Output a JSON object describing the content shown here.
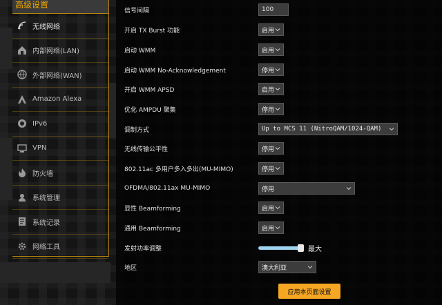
{
  "sidebar": {
    "title": "高级设置",
    "items": [
      {
        "label": "无线网络",
        "icon": "wifi-icon"
      },
      {
        "label": "内部网络(LAN)",
        "icon": "home-icon"
      },
      {
        "label": "外部网络(WAN)",
        "icon": "globe-icon"
      },
      {
        "label": "Amazon Alexa",
        "icon": "alexa-icon"
      },
      {
        "label": "IPv6",
        "icon": "ipv6-icon"
      },
      {
        "label": "VPN",
        "icon": "vpn-icon"
      },
      {
        "label": "防火墙",
        "icon": "firewall-icon"
      },
      {
        "label": "系统管理",
        "icon": "admin-icon"
      },
      {
        "label": "系统记录",
        "icon": "log-icon"
      },
      {
        "label": "网络工具",
        "icon": "tools-icon"
      }
    ]
  },
  "settings": {
    "beacon": {
      "label": "信号间隔",
      "value": "100"
    },
    "tx_burst": {
      "label": "开启 TX Burst 功能",
      "value": "启用"
    },
    "wmm": {
      "label": "启动 WMM",
      "value": "启用"
    },
    "wmm_noack": {
      "label": "启动 WMM No-Acknowledgement",
      "value": "停用"
    },
    "wmm_apsd": {
      "label": "开启 WMM APSD",
      "value": "启用"
    },
    "ampdu": {
      "label": "优化 AMPDU 聚集",
      "value": "停用"
    },
    "modulation": {
      "label": "调制方式",
      "value": "Up to MCS 11 (NitroQAM/1024-QAM)"
    },
    "airtime": {
      "label": "无线传输公平性",
      "value": "停用"
    },
    "mumimo": {
      "label": "802.11ac 多用户多入多出(MU-MIMO)",
      "value": "停用"
    },
    "ofdma": {
      "label": "OFDMA/802.11ax MU-MIMO",
      "value": "停用"
    },
    "explicit_bf": {
      "label": "显性 Beamforming",
      "value": "启用"
    },
    "implicit_bf": {
      "label": "通用 Beamforming",
      "value": "启用"
    },
    "txpower": {
      "label": "发射功率调整",
      "value_label": "最大",
      "level_fraction": 1.0
    },
    "region": {
      "label": "地区",
      "value": "澳大利亚"
    }
  },
  "apply_button": "应用本页面设置",
  "colors": {
    "accent": "#f5a623",
    "brand_gold": "#f2a900",
    "slider": "#9fd4f0"
  }
}
